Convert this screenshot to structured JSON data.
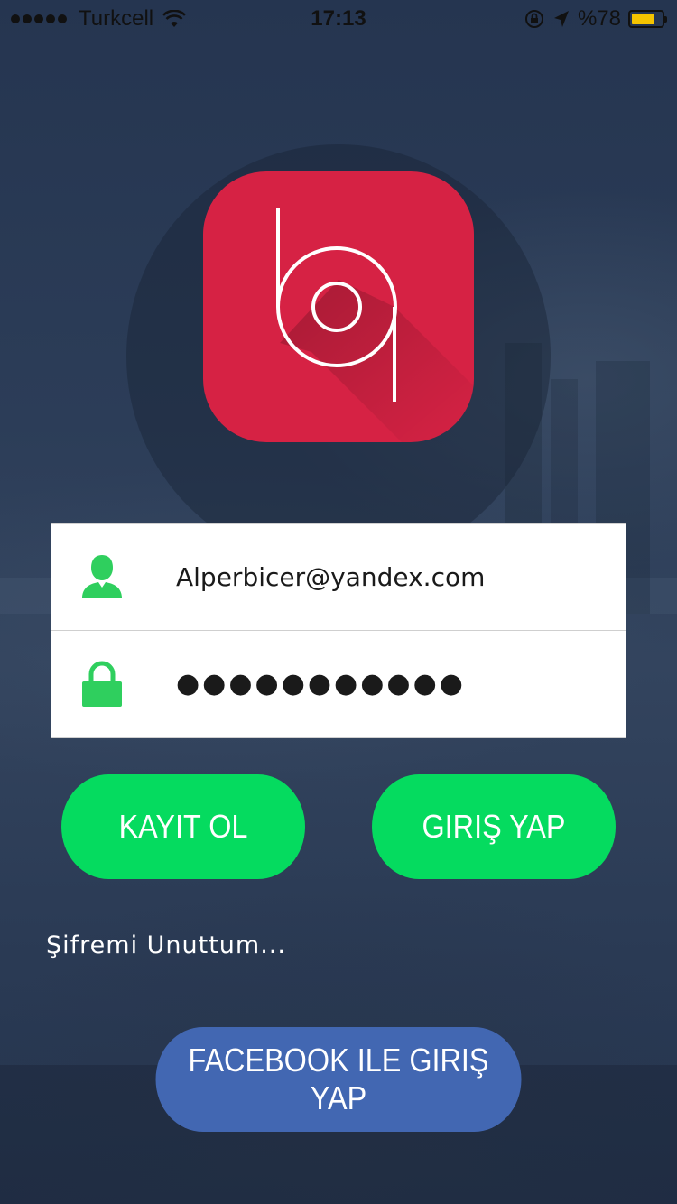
{
  "status_bar": {
    "carrier": "Turkcell",
    "time": "17:13",
    "battery_text": "%78",
    "battery_level": 0.78,
    "battery_color": "#f5c400",
    "icons": [
      "signal-dots-icon",
      "wifi-icon",
      "orientation-lock-icon",
      "location-arrow-icon",
      "battery-icon"
    ]
  },
  "logo": {
    "background_color": "#d62244",
    "icon": "app-logo-icon"
  },
  "login_form": {
    "email": {
      "value": "Alperbicer@yandex.com",
      "icon": "user-icon",
      "icon_color": "#2fcf5e"
    },
    "password": {
      "value": "●●●●●●●●●●●",
      "icon": "lock-icon",
      "icon_color": "#2fcf5e"
    }
  },
  "actions": {
    "register_label": "KAYIT OL",
    "login_label": "GIRIŞ YAP",
    "forgot_label": "Şifremi Unuttum...",
    "facebook_label": "FACEBOOK ILE GIRIŞ YAP",
    "primary_color": "#05db5f",
    "facebook_color": "#4267b2"
  }
}
